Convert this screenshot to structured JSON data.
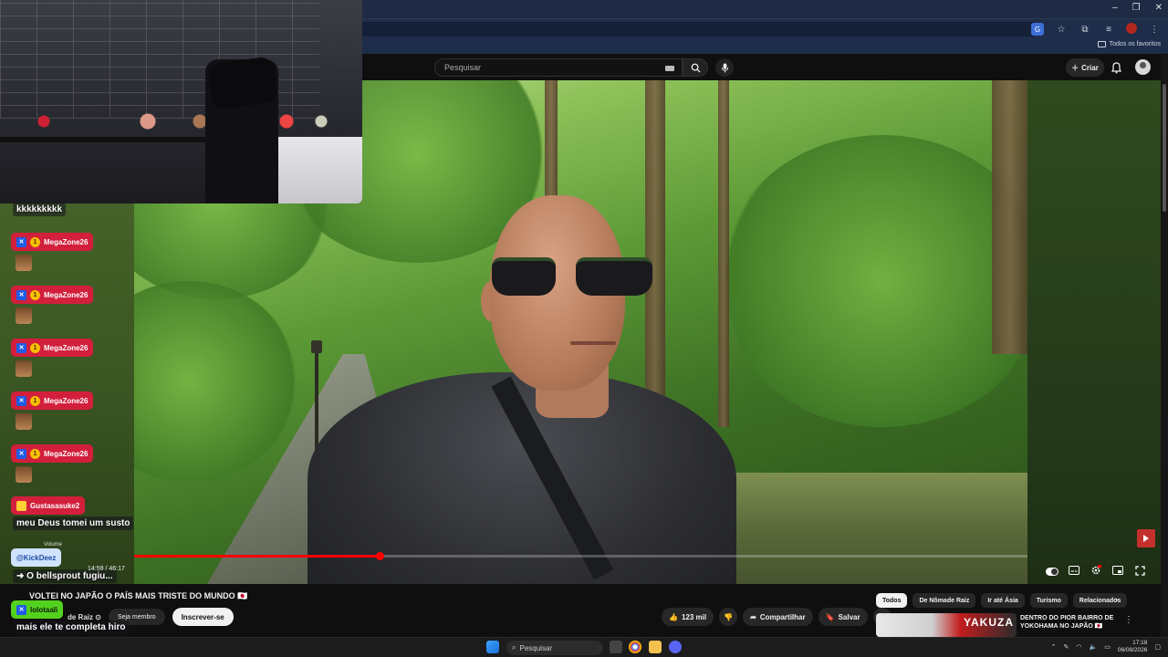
{
  "browser": {
    "bookmarks_all": "Todos os favoritos"
  },
  "masthead": {
    "search_placeholder": "Pesquisar",
    "create_label": "Criar"
  },
  "player": {
    "progress_fraction": 0.275,
    "time_current": "14:59",
    "time_total": "46:17",
    "volume_tooltip": "Volume"
  },
  "video": {
    "title": "VOLTEI NO JAPÃO O PAÍS MAIS TRISTE DO MUNDO 🇯🇵",
    "channel_fragment": "de Raiz ⊙",
    "member_button": "Seja membro",
    "subscribe_button": "Inscrever-se",
    "likes": "123 mil",
    "share_label": "Compartilhar",
    "save_label": "Salvar"
  },
  "chips": [
    "Todos",
    "De Nômade Raiz",
    "Ir até Ásia",
    "Turismo",
    "Relacionados"
  ],
  "recommendation": {
    "thumb_text": "YAKUZA",
    "title": "DENTRO DO PIOR BAIRRO DE YOKOHAMA NO JAPÃO 🇯🇵"
  },
  "chat": {
    "messages": [
      {
        "text": "kkkkkkkkk"
      },
      {
        "user": "MegaZone26"
      },
      {
        "user": "MegaZone26"
      },
      {
        "user": "MegaZone26"
      },
      {
        "user": "MegaZone26"
      },
      {
        "user": "MegaZone26"
      },
      {
        "user": "Gustasasuke2",
        "text": "meu Deus tomei um susto"
      },
      {
        "user": "@KickDeez",
        "text": "O bellsprout fugiu..."
      },
      {
        "user": "lolotaali",
        "text": "mais ele te completa hiro"
      }
    ]
  },
  "taskbar": {
    "search_label": "Pesquisar",
    "time": "17:18",
    "date": "06/08/2026"
  },
  "colors": {
    "accent_red": "#ff0000",
    "chat_red": "#d21f3c",
    "chat_green": "#53d11f",
    "browser_blue": "#1e2d4a"
  }
}
